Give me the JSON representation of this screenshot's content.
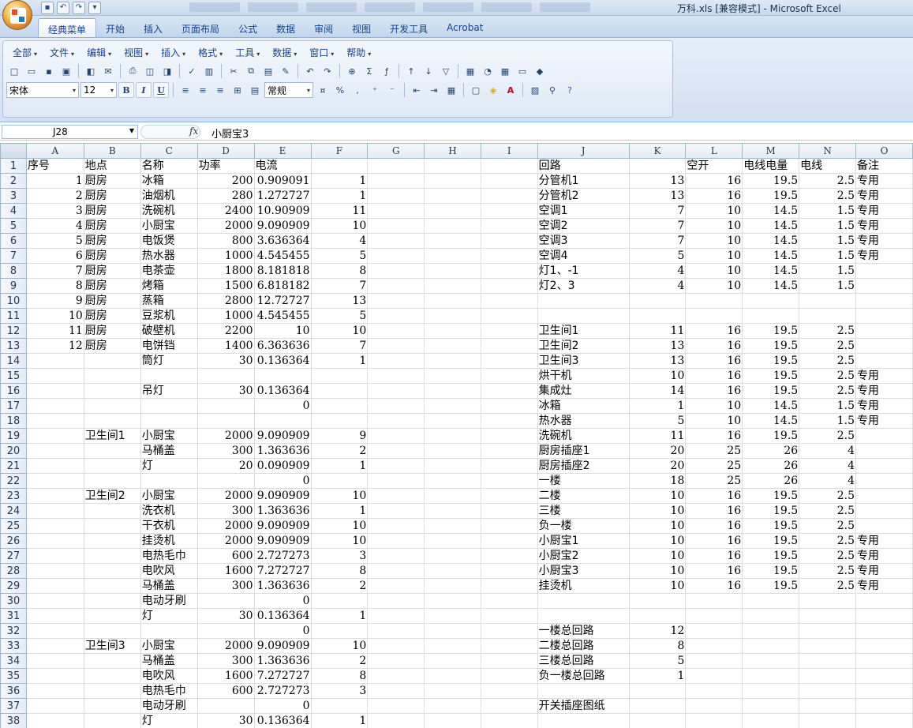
{
  "window": {
    "title": "万科.xls  [兼容模式] - Microsoft Excel"
  },
  "ribbon_tabs": [
    "经典菜单",
    "开始",
    "插入",
    "页面布局",
    "公式",
    "数据",
    "审阅",
    "视图",
    "开发工具",
    "Acrobat"
  ],
  "classic_menu": [
    "全部",
    "文件",
    "编辑",
    "视图",
    "插入",
    "格式",
    "工具",
    "数据",
    "窗口",
    "帮助"
  ],
  "toolbar": {
    "font_name": "宋体",
    "font_size": "12",
    "number_format": "常规",
    "bold": "B",
    "italic": "I",
    "underline": "U",
    "percent": "%",
    "comma": ","
  },
  "formula_bar": {
    "name_box": "J28",
    "fx_label": "fx",
    "content": "小厨宝3"
  },
  "columns": [
    "A",
    "B",
    "C",
    "D",
    "E",
    "F",
    "G",
    "H",
    "I",
    "J",
    "K",
    "L",
    "M",
    "N",
    "O"
  ],
  "rows": [
    [
      "序号",
      "地点",
      "名称",
      "功率",
      "电流",
      "",
      "",
      "",
      "",
      "回路",
      "",
      "空开",
      "电线电量",
      "电线",
      "备注"
    ],
    [
      "1",
      "厨房",
      "冰箱",
      "200",
      "0.909091",
      "1",
      "",
      "",
      "",
      "分管机1",
      "13",
      "16",
      "19.5",
      "2.5",
      "专用"
    ],
    [
      "2",
      "厨房",
      "油烟机",
      "280",
      "1.272727",
      "1",
      "",
      "",
      "",
      "分管机2",
      "13",
      "16",
      "19.5",
      "2.5",
      "专用"
    ],
    [
      "3",
      "厨房",
      "洗碗机",
      "2400",
      "10.90909",
      "11",
      "",
      "",
      "",
      "空调1",
      "7",
      "10",
      "14.5",
      "1.5",
      "专用"
    ],
    [
      "4",
      "厨房",
      "小厨宝",
      "2000",
      "9.090909",
      "10",
      "",
      "",
      "",
      "空调2",
      "7",
      "10",
      "14.5",
      "1.5",
      "专用"
    ],
    [
      "5",
      "厨房",
      "电饭煲",
      "800",
      "3.636364",
      "4",
      "",
      "",
      "",
      "空调3",
      "7",
      "10",
      "14.5",
      "1.5",
      "专用"
    ],
    [
      "6",
      "厨房",
      "热水器",
      "1000",
      "4.545455",
      "5",
      "",
      "",
      "",
      "空调4",
      "5",
      "10",
      "14.5",
      "1.5",
      "专用"
    ],
    [
      "7",
      "厨房",
      "电茶壶",
      "1800",
      "8.181818",
      "8",
      "",
      "",
      "",
      "灯1、-1",
      "4",
      "10",
      "14.5",
      "1.5",
      ""
    ],
    [
      "8",
      "厨房",
      "烤箱",
      "1500",
      "6.818182",
      "7",
      "",
      "",
      "",
      "灯2、3",
      "4",
      "10",
      "14.5",
      "1.5",
      ""
    ],
    [
      "9",
      "厨房",
      "蒸箱",
      "2800",
      "12.72727",
      "13",
      "",
      "",
      "",
      "",
      "",
      "",
      "",
      "",
      ""
    ],
    [
      "10",
      "厨房",
      "豆浆机",
      "1000",
      "4.545455",
      "5",
      "",
      "",
      "",
      "",
      "",
      "",
      "",
      "",
      ""
    ],
    [
      "11",
      "厨房",
      "破壁机",
      "2200",
      "10",
      "10",
      "",
      "",
      "",
      "卫生间1",
      "11",
      "16",
      "19.5",
      "2.5",
      ""
    ],
    [
      "12",
      "厨房",
      "电饼铛",
      "1400",
      "6.363636",
      "7",
      "",
      "",
      "",
      "卫生间2",
      "13",
      "16",
      "19.5",
      "2.5",
      ""
    ],
    [
      "",
      "",
      "筒灯",
      "30",
      "0.136364",
      "1",
      "",
      "",
      "",
      "卫生间3",
      "13",
      "16",
      "19.5",
      "2.5",
      ""
    ],
    [
      "",
      "",
      "",
      "",
      "",
      "",
      "",
      "",
      "",
      "烘干机",
      "10",
      "16",
      "19.5",
      "2.5",
      "专用"
    ],
    [
      "",
      "",
      "吊灯",
      "30",
      "0.136364",
      "",
      "",
      "",
      "",
      "集成灶",
      "14",
      "16",
      "19.5",
      "2.5",
      "专用"
    ],
    [
      "",
      "",
      "",
      "",
      "0",
      "",
      "",
      "",
      "",
      "冰箱",
      "1",
      "10",
      "14.5",
      "1.5",
      "专用"
    ],
    [
      "",
      "",
      "",
      "",
      "",
      "",
      "",
      "",
      "",
      "热水器",
      "5",
      "10",
      "14.5",
      "1.5",
      "专用"
    ],
    [
      "",
      "卫生间1",
      "小厨宝",
      "2000",
      "9.090909",
      "9",
      "",
      "",
      "",
      "洗碗机",
      "11",
      "16",
      "19.5",
      "2.5",
      ""
    ],
    [
      "",
      "",
      "马桶盖",
      "300",
      "1.363636",
      "2",
      "",
      "",
      "",
      "厨房插座1",
      "20",
      "25",
      "26",
      "4",
      ""
    ],
    [
      "",
      "",
      "灯",
      "20",
      "0.090909",
      "1",
      "",
      "",
      "",
      "厨房插座2",
      "20",
      "25",
      "26",
      "4",
      ""
    ],
    [
      "",
      "",
      "",
      "",
      "0",
      "",
      "",
      "",
      "",
      "一楼",
      "18",
      "25",
      "26",
      "4",
      ""
    ],
    [
      "",
      "卫生间2",
      "小厨宝",
      "2000",
      "9.090909",
      "10",
      "",
      "",
      "",
      "二楼",
      "10",
      "16",
      "19.5",
      "2.5",
      ""
    ],
    [
      "",
      "",
      "洗衣机",
      "300",
      "1.363636",
      "1",
      "",
      "",
      "",
      "三楼",
      "10",
      "16",
      "19.5",
      "2.5",
      ""
    ],
    [
      "",
      "",
      "干衣机",
      "2000",
      "9.090909",
      "10",
      "",
      "",
      "",
      "负一楼",
      "10",
      "16",
      "19.5",
      "2.5",
      ""
    ],
    [
      "",
      "",
      "挂烫机",
      "2000",
      "9.090909",
      "10",
      "",
      "",
      "",
      "小厨宝1",
      "10",
      "16",
      "19.5",
      "2.5",
      "专用"
    ],
    [
      "",
      "",
      "电热毛巾",
      "600",
      "2.727273",
      "3",
      "",
      "",
      "",
      "小厨宝2",
      "10",
      "16",
      "19.5",
      "2.5",
      "专用"
    ],
    [
      "",
      "",
      "电吹风",
      "1600",
      "7.272727",
      "8",
      "",
      "",
      "",
      "小厨宝3",
      "10",
      "16",
      "19.5",
      "2.5",
      "专用"
    ],
    [
      "",
      "",
      "马桶盖",
      "300",
      "1.363636",
      "2",
      "",
      "",
      "",
      "挂烫机",
      "10",
      "16",
      "19.5",
      "2.5",
      "专用"
    ],
    [
      "",
      "",
      "电动牙刷",
      "",
      "0",
      "",
      "",
      "",
      "",
      "",
      "",
      "",
      "",
      "",
      ""
    ],
    [
      "",
      "",
      "灯",
      "30",
      "0.136364",
      "1",
      "",
      "",
      "",
      "",
      "",
      "",
      "",
      "",
      ""
    ],
    [
      "",
      "",
      "",
      "",
      "0",
      "",
      "",
      "",
      "",
      "一楼总回路",
      "12",
      "",
      "",
      "",
      ""
    ],
    [
      "",
      "卫生间3",
      "小厨宝",
      "2000",
      "9.090909",
      "10",
      "",
      "",
      "",
      "二楼总回路",
      "8",
      "",
      "",
      "",
      ""
    ],
    [
      "",
      "",
      "马桶盖",
      "300",
      "1.363636",
      "2",
      "",
      "",
      "",
      "三楼总回路",
      "5",
      "",
      "",
      "",
      ""
    ],
    [
      "",
      "",
      "电吹风",
      "1600",
      "7.272727",
      "8",
      "",
      "",
      "",
      "负一楼总回路",
      "1",
      "",
      "",
      "",
      ""
    ],
    [
      "",
      "",
      "电热毛巾",
      "600",
      "2.727273",
      "3",
      "",
      "",
      "",
      "",
      "",
      "",
      "",
      "",
      ""
    ],
    [
      "",
      "",
      "电动牙刷",
      "",
      "0",
      "",
      "",
      "",
      "",
      "开关插座图纸",
      "",
      "",
      "",
      "",
      ""
    ],
    [
      "",
      "",
      "灯",
      "30",
      "0.136364",
      "1",
      "",
      "",
      "",
      "",
      "",
      "",
      "",
      "",
      ""
    ]
  ]
}
